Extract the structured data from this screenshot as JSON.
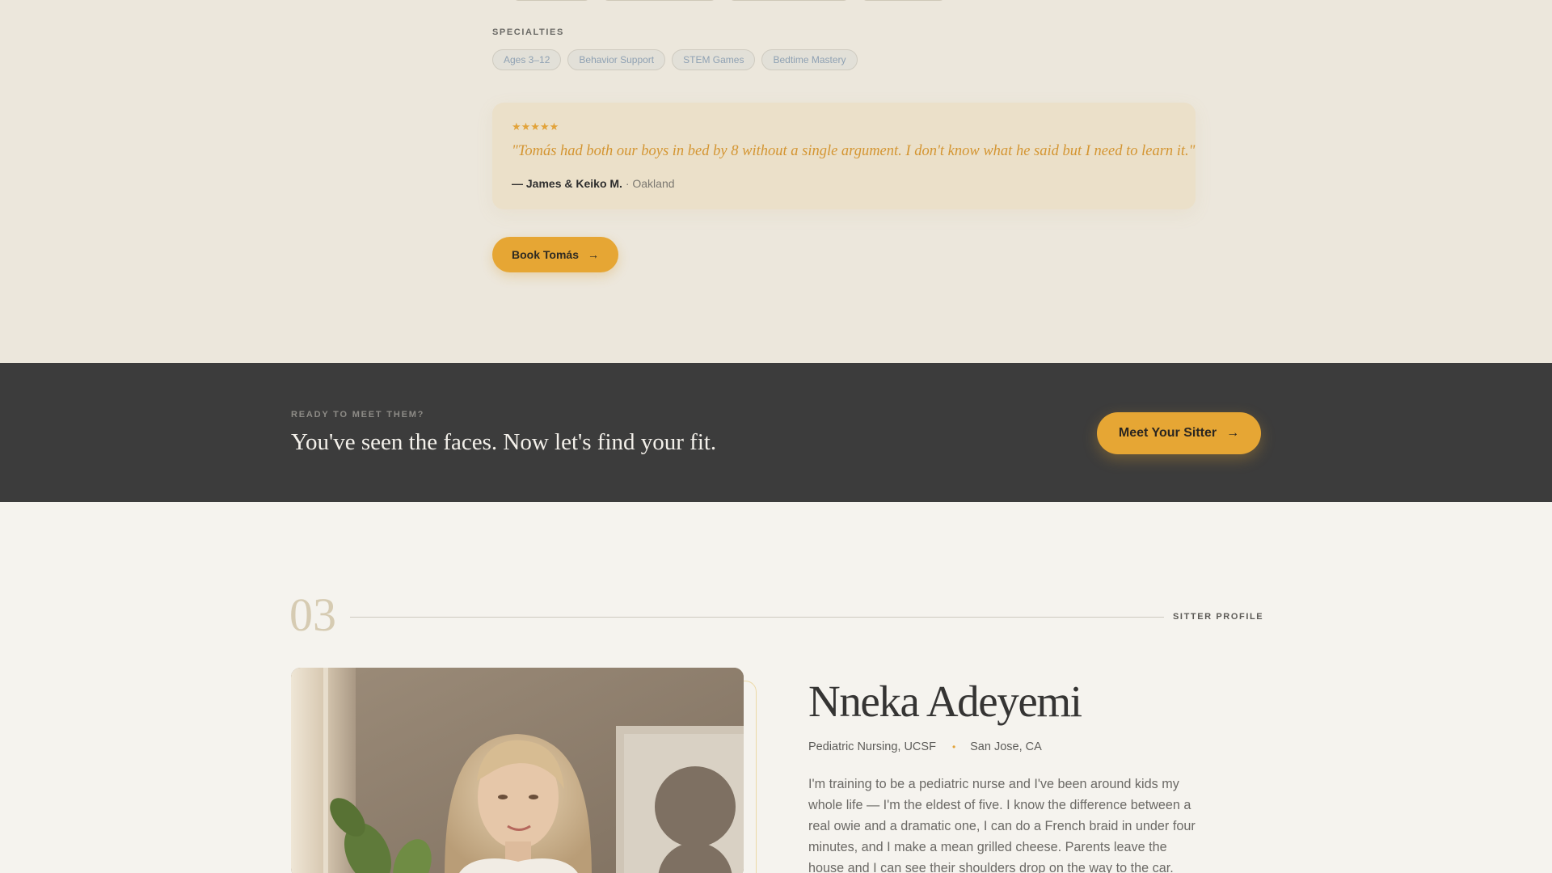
{
  "sitter_tomas": {
    "specialties_label": "SPECIALTIES",
    "specialties": [
      "Ages 3–12",
      "Behavior Support",
      "STEM Games",
      "Bedtime Mastery"
    ],
    "review": {
      "rating": 5,
      "stars": "★★★★★",
      "quote": "\"Tomás had both our boys in bed by 8 without a single argument. I don't know what he said but I need to learn it.\"",
      "author": "— James & Keiko M.",
      "location": "· Oakland"
    },
    "book_button": "Book Tomás",
    "book_arrow": "→"
  },
  "cta_band": {
    "eyebrow": "READY TO MEET THEM?",
    "title": "You've seen the faces. Now let's find your fit.",
    "button": "Meet Your Sitter",
    "button_arrow": "→"
  },
  "profile": {
    "number": "03",
    "section_label": "SITTER PROFILE",
    "name": "Nneka Adeyemi",
    "credential": "Pediatric Nursing, UCSF",
    "separator": "•",
    "location": "San Jose, CA",
    "bio": "I'm training to be a pediatric nurse and I've been around kids my whole life — I'm the eldest of five. I know the difference between a real owie and a dramatic one, I can do a French braid in under four minutes, and I make a mean grilled cheese. Parents leave the house and I can see their shoulders drop on the way to the car."
  },
  "colors": {
    "accent": "#e6a634",
    "dark_band": "#3c3c3c",
    "top_bg": "#ece7dc",
    "page_bg": "#f5f3ee"
  }
}
